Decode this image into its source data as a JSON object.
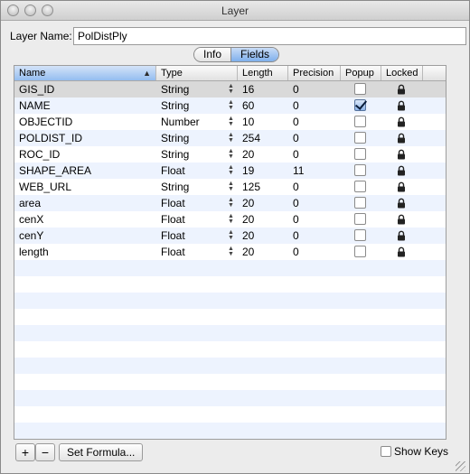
{
  "window": {
    "title": "Layer",
    "ghost_title": "Layer"
  },
  "layer_name": {
    "label": "Layer Name:",
    "value": "PolDistPly"
  },
  "tabs": [
    {
      "label": "Info",
      "selected": false
    },
    {
      "label": "Fields",
      "selected": true
    }
  ],
  "table": {
    "columns": [
      "Name",
      "Type",
      "Length",
      "Precision",
      "Popup",
      "Locked"
    ],
    "sorted_column": "Name",
    "rows": [
      {
        "name": "GIS_ID",
        "type": "String",
        "length": "16",
        "precision": "0",
        "popup": false,
        "locked": true
      },
      {
        "name": "NAME",
        "type": "String",
        "length": "60",
        "precision": "0",
        "popup": true,
        "locked": true
      },
      {
        "name": "OBJECTID",
        "type": "Number",
        "length": "10",
        "precision": "0",
        "popup": false,
        "locked": true
      },
      {
        "name": "POLDIST_ID",
        "type": "String",
        "length": "254",
        "precision": "0",
        "popup": false,
        "locked": true
      },
      {
        "name": "ROC_ID",
        "type": "String",
        "length": "20",
        "precision": "0",
        "popup": false,
        "locked": true
      },
      {
        "name": "SHAPE_AREA",
        "type": "Float",
        "length": "19",
        "precision": "11",
        "popup": false,
        "locked": true
      },
      {
        "name": "WEB_URL",
        "type": "String",
        "length": "125",
        "precision": "0",
        "popup": false,
        "locked": true
      },
      {
        "name": "area",
        "type": "Float",
        "length": "20",
        "precision": "0",
        "popup": false,
        "locked": true
      },
      {
        "name": "cenX",
        "type": "Float",
        "length": "20",
        "precision": "0",
        "popup": false,
        "locked": true
      },
      {
        "name": "cenY",
        "type": "Float",
        "length": "20",
        "precision": "0",
        "popup": false,
        "locked": true
      },
      {
        "name": "length",
        "type": "Float",
        "length": "20",
        "precision": "0",
        "popup": false,
        "locked": true
      }
    ],
    "empty_rows": 11
  },
  "buttons": {
    "add": "+",
    "remove": "−",
    "set_formula": "Set Formula..."
  },
  "show_keys": {
    "label": "Show Keys",
    "checked": false
  },
  "colors": {
    "accent": "#7fb0ec",
    "alt_row": "#edf3fe",
    "selected_row": "#d9d9d9"
  },
  "icons": {
    "sort": "sort-ascending-icon",
    "lock": "lock-icon",
    "stepper": "stepper-icon"
  }
}
